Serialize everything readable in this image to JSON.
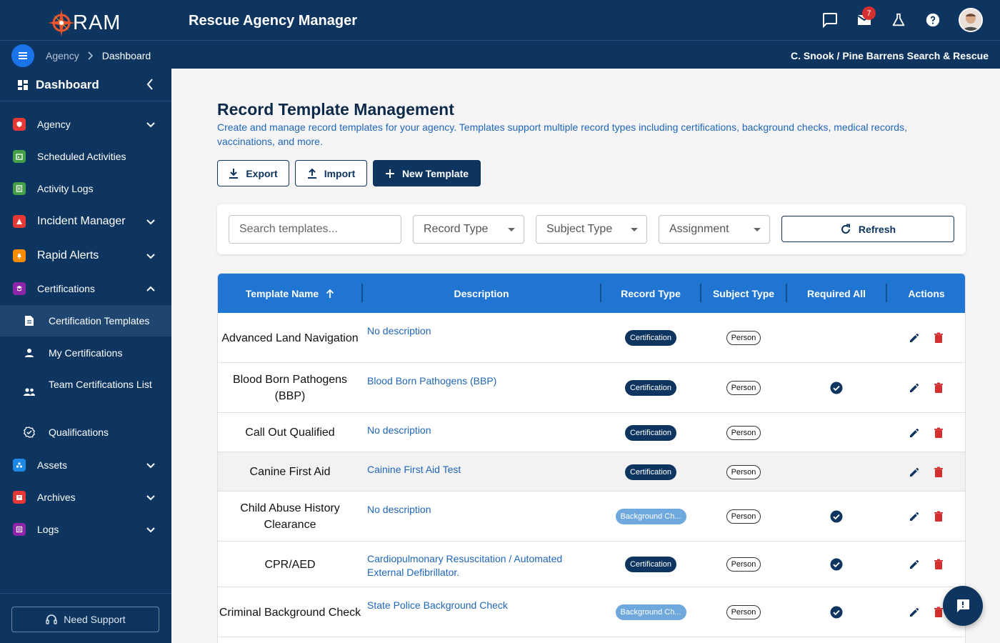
{
  "header": {
    "logo_text": "RAM",
    "app_title": "Rescue Agency Manager",
    "mail_badge": "7",
    "icons": [
      "chat-icon",
      "mail-icon",
      "flask-icon",
      "help-icon"
    ]
  },
  "breadcrumb": {
    "parent": "Agency",
    "current": "Dashboard"
  },
  "user_org": "C. Snook / Pine Barrens Search & Rescue",
  "sidebar": {
    "title": "Dashboard",
    "items": [
      {
        "label": "Agency",
        "color": "#e53935"
      },
      {
        "label": "Scheduled Activities",
        "color": "#43a047"
      },
      {
        "label": "Activity Logs",
        "color": "#43a047"
      },
      {
        "label": "Incident Manager",
        "color": "#e53935"
      },
      {
        "label": "Rapid Alerts",
        "color": "#fb8c00"
      },
      {
        "label": "Certifications",
        "color": "#8e24aa"
      },
      {
        "label": "Assets",
        "color": "#1e88e5"
      },
      {
        "label": "Archives",
        "color": "#e53935"
      },
      {
        "label": "Logs",
        "color": "#8e24aa"
      }
    ],
    "sub_items": [
      {
        "label": "Certification Templates"
      },
      {
        "label": "My Certifications"
      },
      {
        "label": "Team Certifications List"
      },
      {
        "label": "Qualifications"
      }
    ],
    "support_label": "Need Support"
  },
  "page": {
    "title": "Record Template Management",
    "description": "Create and manage record templates for your agency. Templates support multiple record types including certifications, background checks, medical records, vaccinations, and more."
  },
  "toolbar": {
    "export_label": "Export",
    "import_label": "Import",
    "new_label": "New Template"
  },
  "filters": {
    "search_placeholder": "Search templates...",
    "record_type": "Record Type",
    "subject_type": "Subject Type",
    "assignment": "Assignment",
    "refresh_label": "Refresh"
  },
  "table": {
    "columns": [
      "Template Name",
      "Description",
      "Record Type",
      "Subject Type",
      "Required All",
      "Actions"
    ],
    "rows": [
      {
        "name": "Advanced Land Navigation",
        "description": "No description",
        "record_type": "Certification",
        "subject_type": "Person",
        "required_all": false
      },
      {
        "name": "Blood Born Pathogens (BBP)",
        "description": "Blood Born Pathogens (BBP)",
        "record_type": "Certification",
        "subject_type": "Person",
        "required_all": true
      },
      {
        "name": "Call Out Qualified",
        "description": "No description",
        "record_type": "Certification",
        "subject_type": "Person",
        "required_all": false
      },
      {
        "name": "Canine First Aid",
        "description": "Cainine First Aid Test",
        "record_type": "Certification",
        "subject_type": "Person",
        "required_all": false
      },
      {
        "name": "Child Abuse History Clearance",
        "description": "No description",
        "record_type": "Background Ch...",
        "subject_type": "Person",
        "required_all": true
      },
      {
        "name": "CPR/AED",
        "description": "Cardiopulmonary Resuscitation / Automated External Defibrillator.",
        "record_type": "Certification",
        "subject_type": "Person",
        "required_all": true
      },
      {
        "name": "Criminal Background Check",
        "description": "State Police Background Check",
        "record_type": "Background Ch...",
        "subject_type": "Person",
        "required_all": true
      }
    ]
  },
  "colors": {
    "navy": "#0d3560",
    "header_blue": "#1f75d1",
    "link_blue": "#1f66b8",
    "delete_red": "#d32f2f"
  }
}
